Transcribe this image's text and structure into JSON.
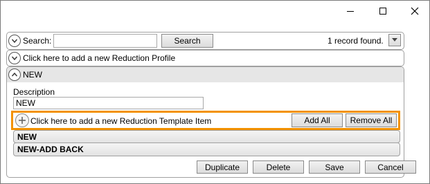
{
  "search_bar": {
    "label": "Search:",
    "input_value": "",
    "button_label": "Search",
    "record_count": "1 record found."
  },
  "add_profile_row": {
    "label": "Click here to add a new Reduction Profile"
  },
  "profile": {
    "name": "NEW",
    "description_label": "Description",
    "description_value": "NEW",
    "template_bar": {
      "add_item_label": "Click here to add a new Reduction Template Item",
      "add_all_label": "Add All",
      "remove_all_label": "Remove All"
    },
    "items": [
      {
        "label": "NEW"
      },
      {
        "label": "NEW-ADD BACK"
      }
    ]
  },
  "actions": {
    "duplicate": "Duplicate",
    "delete": "Delete",
    "save": "Save",
    "cancel": "Cancel"
  },
  "colors": {
    "highlight": "#f39200",
    "header_gray": "#e6e6e6"
  }
}
